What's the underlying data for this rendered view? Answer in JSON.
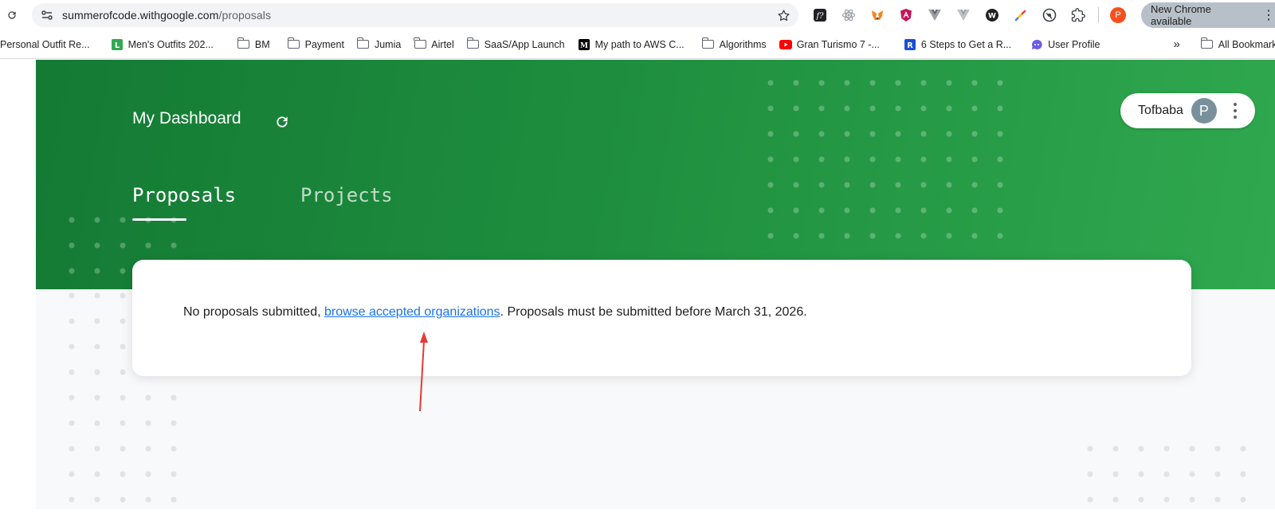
{
  "browser": {
    "url_host": "summerofcode.withgoogle.com",
    "url_path": "/proposals",
    "update_label": "New Chrome available",
    "profile_initial": "P",
    "bookmarks": [
      {
        "label": "Personal Outfit Re...",
        "icon": "none"
      },
      {
        "label": "Men's Outfits 202...",
        "icon": "l-badge"
      },
      {
        "label": "BM",
        "icon": "folder"
      },
      {
        "label": "Payment",
        "icon": "folder"
      },
      {
        "label": "Jumia",
        "icon": "folder"
      },
      {
        "label": "Airtel",
        "icon": "folder"
      },
      {
        "label": "SaaS/App Launch",
        "icon": "folder"
      },
      {
        "label": "My path to AWS C...",
        "icon": "medium"
      },
      {
        "label": "Algorithms",
        "icon": "folder"
      },
      {
        "label": "Gran Turismo 7 -...",
        "icon": "youtube"
      },
      {
        "label": "6 Steps to Get a R...",
        "icon": "r-badge"
      },
      {
        "label": "User Profile",
        "icon": "chat"
      }
    ],
    "all_bookmarks_label": "All Bookmarks"
  },
  "dashboard": {
    "title": "My Dashboard",
    "user_name": "Tofbaba",
    "avatar_initial": "P",
    "tabs": [
      {
        "label": "Proposals",
        "active": true
      },
      {
        "label": "Projects",
        "active": false
      }
    ],
    "message": {
      "prefix": "No proposals submitted, ",
      "link_text": "browse accepted organizations",
      "suffix": ". Proposals must be submitted before March 31, 2026."
    }
  },
  "colors": {
    "hero_green": "#1e8e3e",
    "link_blue": "#1a73e8",
    "annotation_red": "#e53935"
  }
}
